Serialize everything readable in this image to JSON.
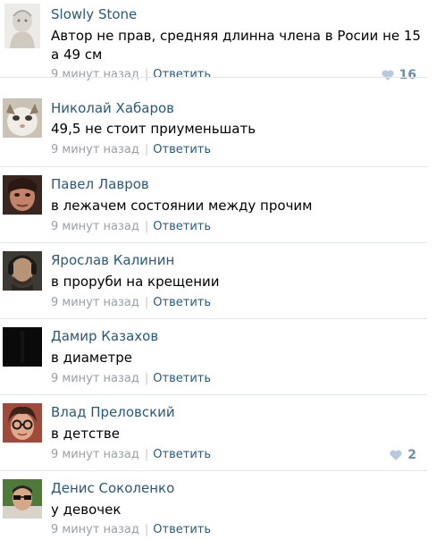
{
  "comments": [
    {
      "author": "Slowly Stone",
      "text": "Автор не прав, средняя длинна члена в Росии не 15 а 49 см",
      "time": "9 минут назад",
      "reply": "Ответить",
      "likes": "16"
    },
    {
      "author": "Николай Хабаров",
      "text": "49,5 не стоит приуменьшать",
      "time": "9 минут назад",
      "reply": "Ответить",
      "likes": null
    },
    {
      "author": "Павел Лавров",
      "text": "в лежачем состоянии между прочим",
      "time": "9 минут назад",
      "reply": "Ответить",
      "likes": null
    },
    {
      "author": "Ярослав Калинин",
      "text": "в проруби на крещении",
      "time": "9 минут назад",
      "reply": "Ответить",
      "likes": null
    },
    {
      "author": "Дамир Казахов",
      "text": "в диаметре",
      "time": "9 минут назад",
      "reply": "Ответить",
      "likes": null
    },
    {
      "author": "Влад Преловский",
      "text": "в детстве",
      "time": "9 минут назад",
      "reply": "Ответить",
      "likes": "2"
    },
    {
      "author": "Денис Соколенко",
      "text": "у девочек",
      "time": "9 минут назад",
      "reply": "Ответить",
      "likes": null
    }
  ],
  "icons": {
    "like": "heart-icon"
  },
  "colors": {
    "author_link": "#2b587a",
    "meta": "#999fa6",
    "like": "#b7c9dc",
    "like_count": "#6b8db0"
  }
}
